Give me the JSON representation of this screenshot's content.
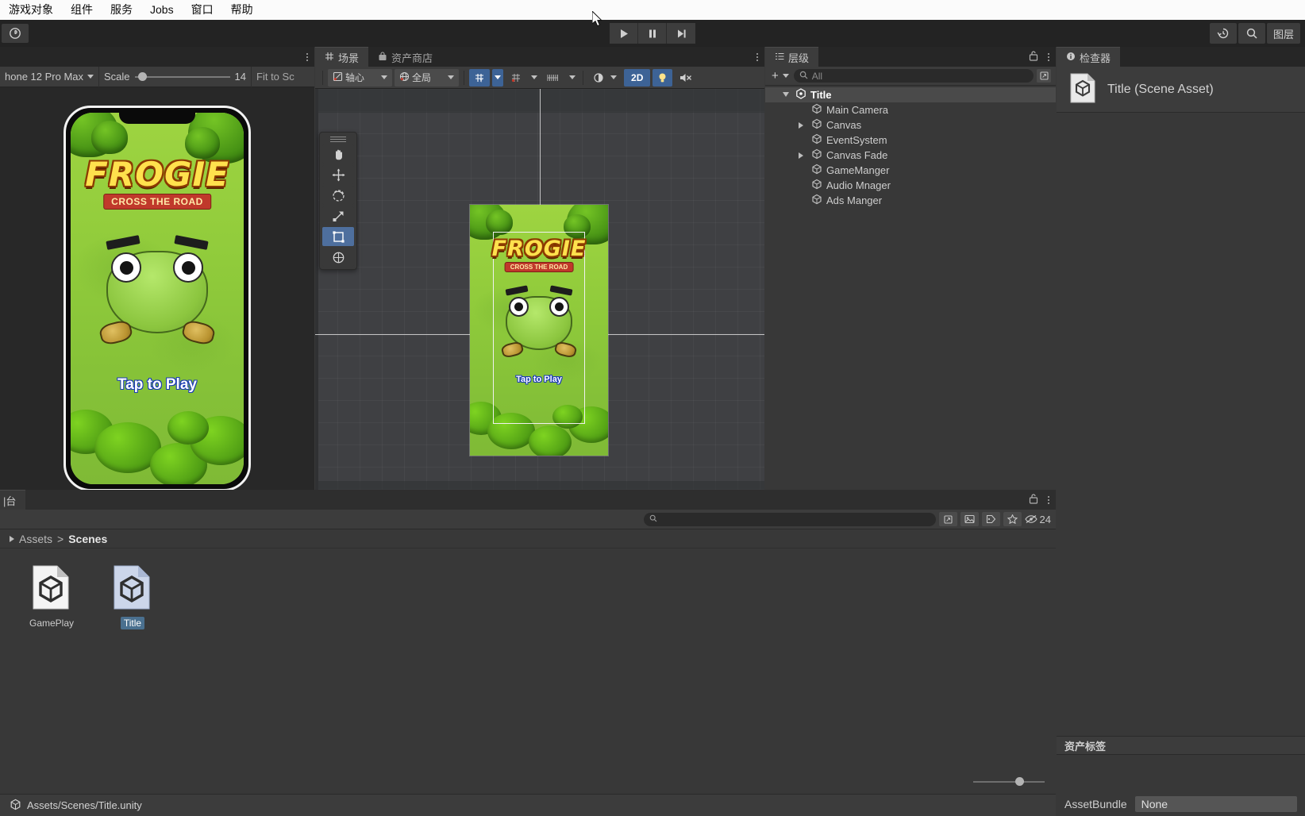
{
  "menubar": {
    "items": [
      {
        "label": "游戏对象",
        "name": "menu-gameobject"
      },
      {
        "label": "组件",
        "name": "menu-component"
      },
      {
        "label": "服务",
        "name": "menu-services"
      },
      {
        "label": "Jobs",
        "name": "menu-jobs"
      },
      {
        "label": "窗口",
        "name": "menu-window"
      },
      {
        "label": "帮助",
        "name": "menu-help"
      }
    ]
  },
  "toolbar": {
    "account_icon": "unity-cloud-icon",
    "play": "play-icon",
    "pause": "pause-icon",
    "step": "step-icon",
    "history_label": "history-icon",
    "search_label": "search-icon",
    "layers_label": "图层"
  },
  "gameview": {
    "device": "hone 12 Pro Max",
    "scale_label": "Scale",
    "scale_value": "14",
    "fit_label": "Fit to Sc",
    "game_art": {
      "logo_main": "FROGIE",
      "logo_sub": "CROSS THE ROAD",
      "tap_text": "Tap to Play"
    }
  },
  "sceneview": {
    "tabs": [
      {
        "label": "场景",
        "icon": "grid-icon",
        "active": true
      },
      {
        "label": "资产商店",
        "icon": "store-icon",
        "active": false
      }
    ],
    "toolbar": {
      "pivot": "轴心",
      "space": "全局",
      "grid_snap": "snap-grid-icon",
      "grid_visibility": "grid-visibility-icon",
      "scale_ruler": "ruler-icon",
      "shading": "shading-icon",
      "two_d": "2D",
      "light": "light-icon",
      "audio": "audio-mute-icon"
    },
    "tools": [
      {
        "name": "hand-tool",
        "icon": "hand-icon",
        "active": false
      },
      {
        "name": "move-tool",
        "icon": "move-icon",
        "active": false
      },
      {
        "name": "rotate-tool",
        "icon": "rotate-icon",
        "active": false
      },
      {
        "name": "scale-tool",
        "icon": "scale-icon",
        "active": false
      },
      {
        "name": "rect-tool",
        "icon": "rect-icon",
        "active": true
      },
      {
        "name": "transform-tool",
        "icon": "transform-icon",
        "active": false
      }
    ]
  },
  "hierarchy": {
    "tab_label": "层级",
    "add_label": "+",
    "search_placeholder": "All",
    "items": [
      {
        "label": "Title",
        "depth": 0,
        "type": "scene",
        "expanded": true
      },
      {
        "label": "Main Camera",
        "depth": 1,
        "type": "object",
        "expandable": false
      },
      {
        "label": "Canvas",
        "depth": 1,
        "type": "object",
        "expandable": true
      },
      {
        "label": "EventSystem",
        "depth": 1,
        "type": "object",
        "expandable": false
      },
      {
        "label": "Canvas Fade",
        "depth": 1,
        "type": "object",
        "expandable": true
      },
      {
        "label": "GameManger",
        "depth": 1,
        "type": "object",
        "expandable": false
      },
      {
        "label": "Audio Mnager",
        "depth": 1,
        "type": "object",
        "expandable": false
      },
      {
        "label": "Ads Manger",
        "depth": 1,
        "type": "object",
        "expandable": false
      }
    ]
  },
  "inspector": {
    "tab_label": "检查器",
    "asset_title": "Title (Scene Asset)",
    "labels_section": "资产标签",
    "assetbundle_label": "AssetBundle",
    "assetbundle_value": "None"
  },
  "project": {
    "tab_label": "|台",
    "search_placeholder": "",
    "item_count": "24",
    "breadcrumb": [
      "Assets",
      "Scenes"
    ],
    "items": [
      {
        "label": "GamePlay",
        "selected": false
      },
      {
        "label": "Title",
        "selected": true
      }
    ]
  },
  "statusbar": {
    "path": "Assets/Scenes/Title.unity"
  },
  "colors": {
    "accent_blue": "#3d6396",
    "selection_blue": "#4a708f",
    "panel_bg": "#383838",
    "toolbar_bg": "#3c3c3c",
    "dark_bg": "#232323"
  }
}
